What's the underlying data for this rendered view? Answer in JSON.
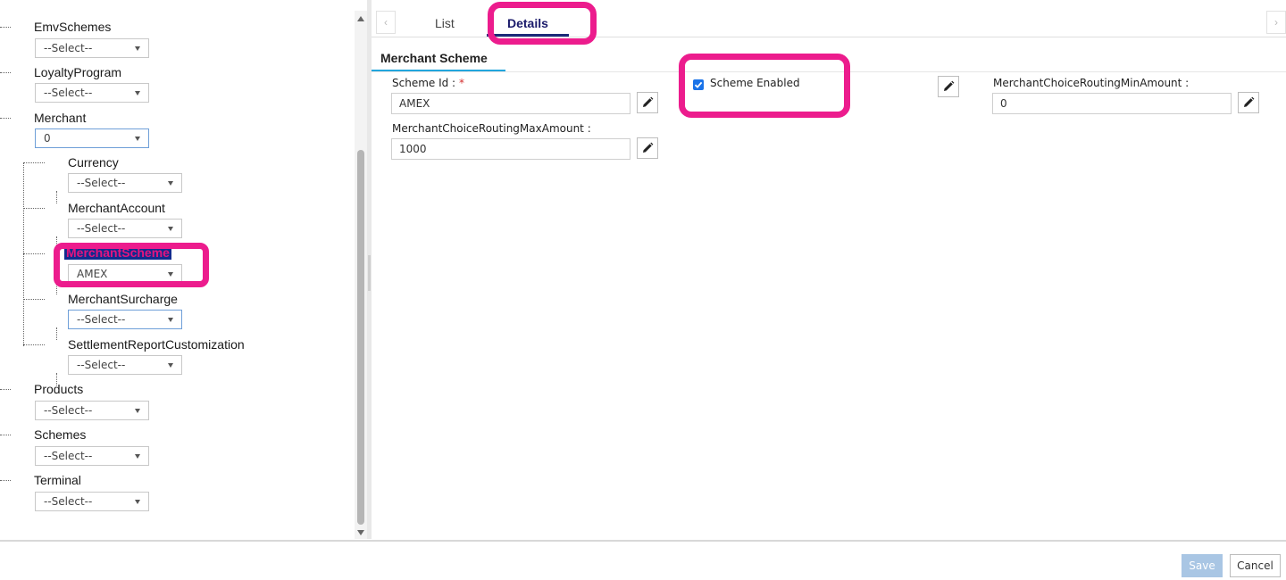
{
  "tree": {
    "top_nodes": [
      {
        "label": "EmvSchemes",
        "value": "--Select--"
      },
      {
        "label": "LoyaltyProgram",
        "value": "--Select--"
      },
      {
        "label": "Merchant",
        "value": "0"
      }
    ],
    "child_nodes": [
      {
        "label": "Currency",
        "value": "--Select--"
      },
      {
        "label": "MerchantAccount",
        "value": "--Select--"
      },
      {
        "label": "MerchantScheme",
        "value": "AMEX"
      },
      {
        "label": "MerchantSurcharge",
        "value": "--Select--"
      },
      {
        "label": "SettlementReportCustomization",
        "value": "--Select--"
      }
    ],
    "bottom_nodes": [
      {
        "label": "Products",
        "value": "--Select--"
      },
      {
        "label": "Schemes",
        "value": "--Select--"
      },
      {
        "label": "Terminal",
        "value": "--Select--"
      }
    ]
  },
  "tabs": {
    "prev": "‹",
    "next": "›",
    "list": "List",
    "details": "Details"
  },
  "section": {
    "title": "Merchant Scheme"
  },
  "form": {
    "scheme_id_label": "Scheme Id :",
    "scheme_id_required": "*",
    "scheme_id_value": "AMEX",
    "scheme_enabled_label": "Scheme Enabled",
    "scheme_enabled_checked": true,
    "min_amount_label": "MerchantChoiceRoutingMinAmount :",
    "min_amount_value": "0",
    "max_amount_label": "MerchantChoiceRoutingMaxAmount :",
    "max_amount_value": "1000"
  },
  "footer": {
    "save": "Save",
    "cancel": "Cancel"
  },
  "colors": {
    "accent": "#22a6dd",
    "annotation": "#ec1c8d",
    "checkbox": "#1a73e8"
  }
}
